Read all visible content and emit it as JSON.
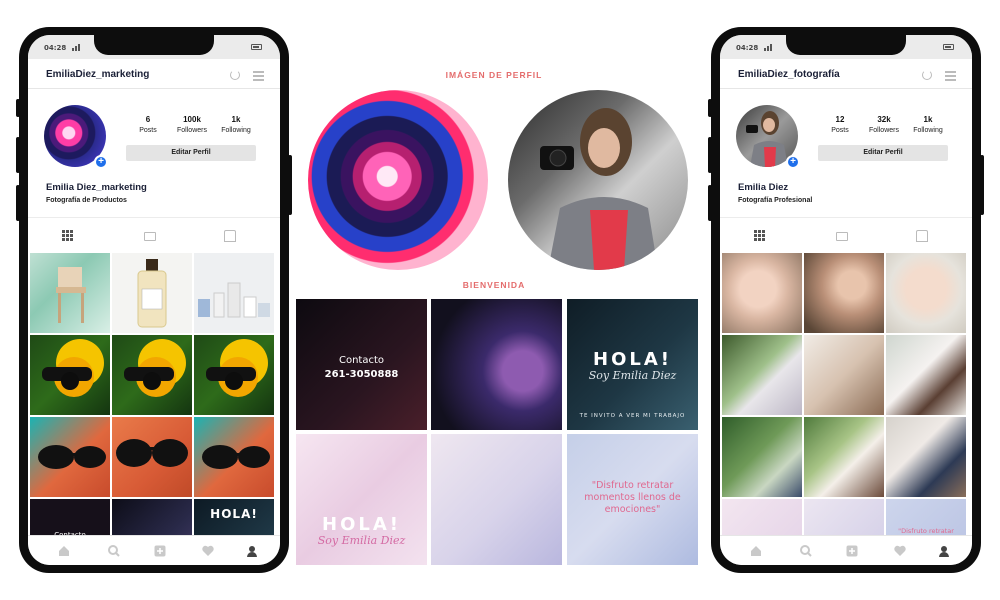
{
  "center": {
    "profile_title": "IMÁGEN DE PERFIL",
    "welcome_title": "BIENVENIDA",
    "tile_contact_label": "Contacto",
    "tile_contact_phone": "261-3050888",
    "tile_hola": "HOLA!",
    "tile_soy": "Soy Emilia Diez",
    "tile_invite": "TE INVITO A VER MI TRABAJO",
    "tile_hola2": "HOLA!",
    "tile_soy2": "Soy Emilia Diez",
    "tile_quote": "\"Disfruto retratar momentos llenos de emociones\""
  },
  "phone_left": {
    "time": "04:28",
    "username": "EmiliaDiez_marketing",
    "stats": [
      {
        "num": "6",
        "label": "Posts"
      },
      {
        "num": "100k",
        "label": "Followers"
      },
      {
        "num": "1k",
        "label": "Following"
      }
    ],
    "edit_label": "Editar Perfil",
    "name": "Emilia Diez_marketing",
    "description": "Fotografía de Productos",
    "contact_snippet": "Contacto",
    "hola_snippet": "HOLA!"
  },
  "phone_right": {
    "time": "04:28",
    "username": "EmiliaDiez_fotografía",
    "stats": [
      {
        "num": "12",
        "label": "Posts"
      },
      {
        "num": "32k",
        "label": "Followers"
      },
      {
        "num": "1k",
        "label": "Following"
      }
    ],
    "edit_label": "Editar Perfil",
    "name": "Emilia Diez",
    "description": "Fotografía Profesional",
    "quote_snippet": "\"Disfruto retratar"
  },
  "icons": [
    "home-icon",
    "search-icon",
    "add-post-icon",
    "heart-icon",
    "profile-icon",
    "grid-icon",
    "reels-icon",
    "tagged-icon",
    "reload-icon",
    "menu-icon"
  ],
  "colors": {
    "accent_title": "#e46c6c",
    "link_blue": "#1f6feb",
    "quote_pink": "#e0688f",
    "phone_frame": "#0d0d0d"
  }
}
